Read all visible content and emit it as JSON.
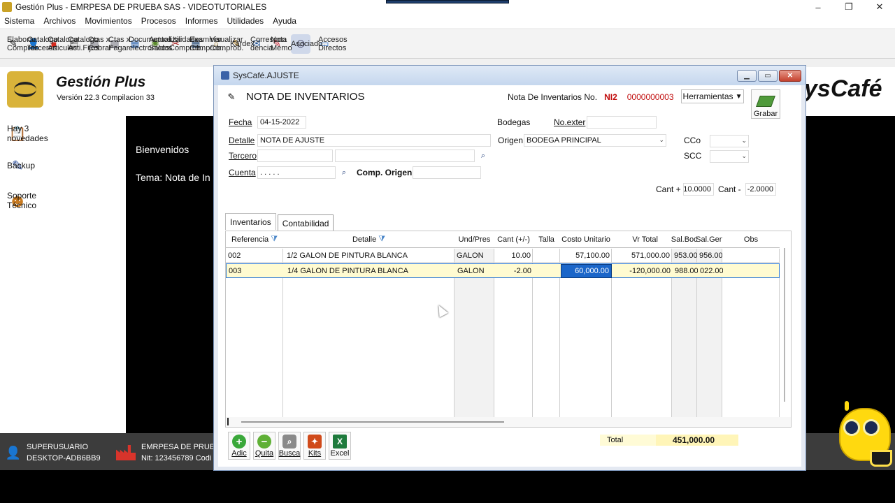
{
  "window": {
    "title": "Gestión Plus - EMRPESA DE PRUEBA SAS - VIDEOTUTORIALES",
    "controls": [
      "–",
      "❐",
      "✕"
    ]
  },
  "menu": [
    "Sistema",
    "Archivos",
    "Movimientos",
    "Procesos",
    "Informes",
    "Utilidades",
    "Ayuda"
  ],
  "toolbar": [
    {
      "label": "Elaborar\nComprob.",
      "icon": "pencil-doc-icon"
    },
    {
      "label": "Catalogo\nTerceros",
      "icon": "person-icon"
    },
    {
      "label": "Catalogo\nArticulos",
      "icon": "red-cube-icon"
    },
    {
      "label": "Catalogo\nActi.Fijos",
      "icon": "fixed-asset-icon"
    },
    {
      "label": "Ctas x\nCobrar",
      "icon": "receivable-icon"
    },
    {
      "label": "Ctas x\nPagar",
      "icon": "payable-icon"
    },
    {
      "label": "Documentos\nelectronicos",
      "icon": "edocs-icon"
    },
    {
      "label": "Actualizar\nSaldos",
      "icon": "refresh-gear-icon"
    },
    {
      "label": "Utilidades\nComprob.",
      "icon": "tools-icon"
    },
    {
      "label": "Examinar\nComprob.",
      "icon": "examine-icon"
    },
    {
      "label": "Visualizar\nComprob.",
      "icon": "view-icon"
    },
    {
      "label": "Kardex",
      "icon": "kardex-icon"
    },
    {
      "label": "Correspon\ndencia",
      "icon": "mail-icon"
    },
    {
      "label": "Nota\nMemo",
      "icon": "note-icon"
    },
    {
      "label": "Asociado",
      "icon": "associate-icon"
    },
    {
      "label": "Accesos\nDirectos",
      "icon": "folder-icon"
    }
  ],
  "brand": {
    "name": "Gestión Plus",
    "version": "Versión 22.3  Compilacion 33",
    "right_brand": "ysCafé"
  },
  "sidebar": [
    {
      "label": "Hay 3 novedades",
      "icon": "clipboard-icon"
    },
    {
      "label": "Backup",
      "icon": "backup-pencil-icon"
    },
    {
      "label": "Soporte Técnico",
      "icon": "support-headset-icon"
    }
  ],
  "main": {
    "welcome": "Bienvenidos",
    "theme": "Tema: Nota de In"
  },
  "status": {
    "user": "SUPERUSUARIO",
    "machine": "DESKTOP-ADB6BB9",
    "company": "EMRPESA DE PRUE",
    "nit": "Nit: 123456789   Codi"
  },
  "dialog": {
    "title": "SysCafé.AJUSTE",
    "heading": "NOTA DE INVENTARIOS",
    "doc_label": "Nota De Inventarios No.",
    "doc_prefix": "NI2",
    "doc_number": "0000000003",
    "tools_label": "Herramientas",
    "save_label": "Grabar",
    "form": {
      "fecha_label": "Fecha",
      "fecha": "04-15-2022",
      "bodegas_label": "Bodegas",
      "noexter_label": "No.exter",
      "noexter": "",
      "detalle_label": "Detalle",
      "detalle": "NOTA DE AJUSTE",
      "origen_label": "Origen",
      "origen": "BODEGA PRINCIPAL",
      "cco_label": "CCo",
      "tercero_label": "Tercero",
      "scc_label": "SCC",
      "cuenta_label": "Cuenta",
      "cuenta": ". . . . .",
      "comp_origen_label": "Comp. Origen",
      "cant_plus_label": "Cant +",
      "cant_plus": "10.0000",
      "cant_minus_label": "Cant -",
      "cant_minus": "-2.0000"
    },
    "tabs": [
      "Inventarios",
      "Contabilidad"
    ],
    "grid": {
      "headers": [
        "Referencia",
        "Detalle",
        "Und/Pres",
        "Cant (+/-)",
        "Talla",
        "Costo Unitario",
        "Vr Total",
        "Sal.Bod",
        "Sal.Gen",
        "Obs"
      ],
      "rows": [
        [
          "002",
          "1/2 GALON DE PINTURA BLANCA",
          "GALON",
          "10.00",
          "",
          "57,100.00",
          "571,000.00",
          "953.00",
          "956.00",
          ""
        ],
        [
          "003",
          "1/4 GALON DE PINTURA BLANCA",
          "GALON",
          "-2.00",
          "",
          "60,000.00",
          "-120,000.00",
          "988.00",
          "022.00",
          ""
        ]
      ]
    },
    "buttons": [
      {
        "label": "Adic",
        "icon": "add-icon",
        "color": "#3aa83a"
      },
      {
        "label": "Quita",
        "icon": "remove-icon",
        "color": "#5fb036"
      },
      {
        "label": "Busca",
        "icon": "binoculars-icon",
        "color": "#6a6a6a"
      },
      {
        "label": "Kits",
        "icon": "kits-icon",
        "color": "#d04a1a"
      },
      {
        "label": "Excel",
        "icon": "excel-icon",
        "color": "#1e7a3c"
      }
    ],
    "total_label": "Total",
    "total": "451,000.00"
  }
}
